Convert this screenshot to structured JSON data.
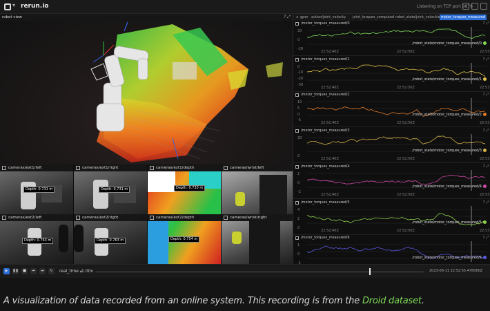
{
  "app": {
    "name": "rerun.io",
    "status": "Listening on TCP port 9876"
  },
  "robot_view": {
    "title": "robot view"
  },
  "cameras": [
    {
      "title": "cameras/ext1/left",
      "depth": "Depth: 0.731 m"
    },
    {
      "title": "cameras/ext1/right",
      "depth": "Depth: 0.731 m"
    },
    {
      "title": "cameras/ext1/depth",
      "depth": "Depth: 0.733 m"
    },
    {
      "title": "cameras/wrist/left",
      "depth": ""
    },
    {
      "title": "cameras/ext2/left",
      "depth": "Depth: 0.763 m"
    },
    {
      "title": "cameras/ext2/right",
      "depth": "Depth: 0.763 m"
    },
    {
      "title": "cameras/ext2/depth",
      "depth": "Depth: 0.754 m"
    },
    {
      "title": "cameras/wrist/right",
      "depth": ""
    }
  ],
  "tabs": [
    {
      "label": "gper",
      "active": false
    },
    {
      "label": "action/joint_velocity",
      "active": false
    },
    {
      "label": "joint_torques_computed",
      "active": false
    },
    {
      "label": "robot_state/joint_velocities",
      "active": false
    },
    {
      "label": "motor_torques_measured",
      "active": true
    }
  ],
  "timeseries": [
    {
      "title": "/motor_torques_measured/0",
      "legend": "/robot_state/motor_torques_measured/0",
      "color": "#7ed957",
      "yticks": [
        "20",
        "0",
        "-20"
      ],
      "x0": "22:52:40Z",
      "x1": "22:52:50Z",
      "x2": "22:53"
    },
    {
      "title": "/motor_torques_measured/1",
      "legend": "/robot_state/motor_torques_measured/1",
      "color": "#e0c24a",
      "yticks": [
        "0",
        "-10",
        "-20",
        "-30"
      ],
      "x0": "22:52:40Z",
      "x1": "22:52:50Z",
      "x2": "22:53"
    },
    {
      "title": "/motor_torques_measured/2",
      "legend": "/robot_state/motor_torques_measured/2",
      "color": "#e07a2a",
      "yticks": [
        "10",
        "5",
        "0",
        "-5"
      ],
      "x0": "22:52:40Z",
      "x1": "22:52:50Z",
      "x2": "22:53"
    },
    {
      "title": "/motor_torques_measured/3",
      "legend": "/robot_state/motor_torques_measured/3",
      "color": "#d9b34a",
      "yticks": [
        "20",
        "0"
      ],
      "x0": "22:52:40Z",
      "x1": "22:52:50Z",
      "x2": "22:53"
    },
    {
      "title": "/motor_torques_measured/4",
      "legend": "/robot_state/motor_torques_measured/4",
      "color": "#d04aa8",
      "yticks": [
        "2",
        "0",
        "-2"
      ],
      "x0": "22:52:40Z",
      "x1": "22:52:50Z",
      "x2": "22:53"
    },
    {
      "title": "/motor_torques_measured/5",
      "legend": "/robot_state/motor_torques_measured/5",
      "color": "#8fd14f",
      "yticks": [
        "4",
        "2",
        "0"
      ],
      "x0": "22:52:40Z",
      "x1": "22:52:50Z",
      "x2": "22:53"
    },
    {
      "title": "/motor_torques_measured/6",
      "legend": "/robot_state/motor_torques_measured/6",
      "color": "#5a5ae0",
      "yticks": [
        "1",
        "0",
        "-1"
      ],
      "x0": "22:52:40Z",
      "x1": "22:52:50Z",
      "x2": "22:53"
    }
  ],
  "timebar": {
    "timeline": "real_time",
    "speed": "1.00x",
    "time": "2023-06-11 22:52:55.478060Z"
  },
  "caption": {
    "text": "A visualization of data recorded from an online system. This recording is from the ",
    "link": "Droid dataset",
    "end": "."
  }
}
